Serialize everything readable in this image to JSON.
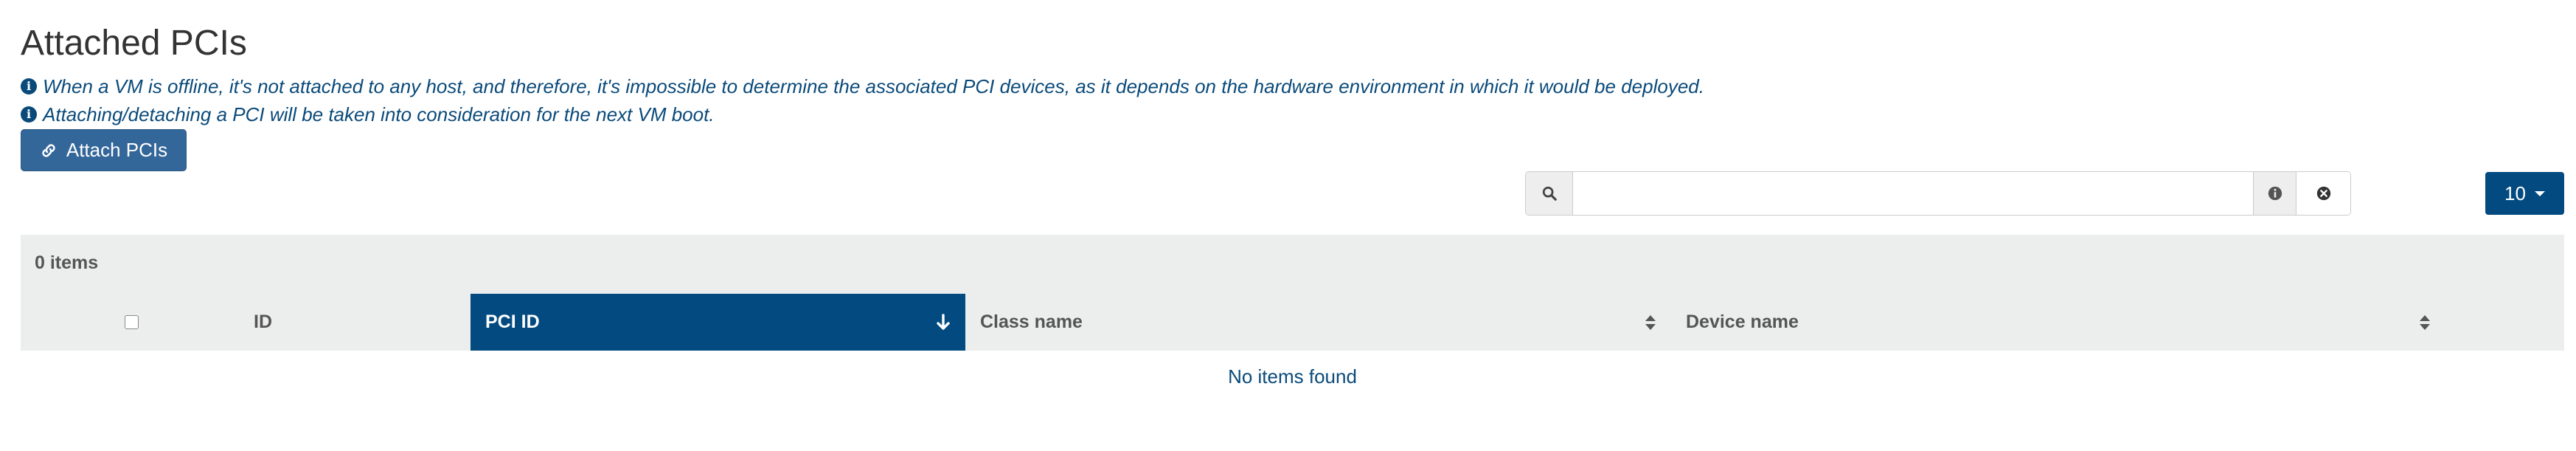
{
  "page": {
    "title": "Attached PCIs",
    "notes": [
      "When a VM is offline, it's not attached to any host, and therefore, it's impossible to determine the associated PCI devices, as it depends on the hardware environment in which it would be deployed.",
      "Attaching/detaching a PCI will be taken into consideration for the next VM boot."
    ]
  },
  "toolbar": {
    "attach_label": "Attach PCIs",
    "search_value": "",
    "page_size": "10"
  },
  "table": {
    "items_count": "0 items",
    "columns": [
      "ID",
      "PCI ID",
      "Class name",
      "Device name"
    ],
    "sorted_column": "PCI ID",
    "sort_direction": "descending",
    "rows": [],
    "empty_message": "No items found"
  },
  "colors": {
    "primary": "#034a80",
    "button": "#336699",
    "link_text": "#0a4a7a",
    "panel_bg": "#eceded"
  },
  "icons": [
    "info-icon",
    "link-icon",
    "search-icon",
    "info-circle-icon",
    "clear-circle-icon",
    "caret-down-icon",
    "arrow-down-icon",
    "sort-icon"
  ]
}
